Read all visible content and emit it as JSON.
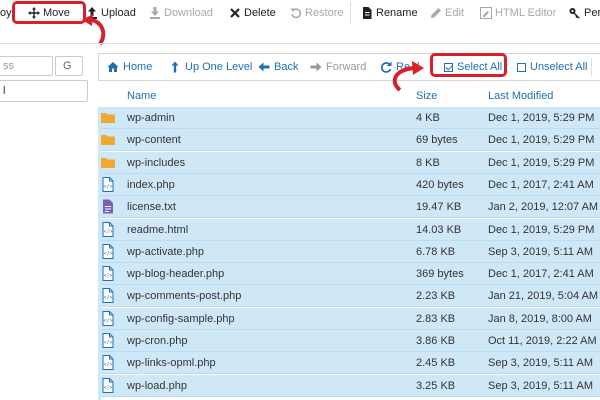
{
  "toolbar": {
    "partial_left": "oy",
    "move": "Move",
    "upload": "Upload",
    "download": "Download",
    "delete": "Delete",
    "restore": "Restore",
    "rename": "Rename",
    "edit": "Edit",
    "html_editor": "HTML Editor",
    "permissions_partial": "Per"
  },
  "left_panel": {
    "search_partial": "ss",
    "go_partial": "G",
    "tree_item_partial": "l"
  },
  "nav": {
    "home": "Home",
    "up_one_level": "Up One Level",
    "back": "Back",
    "forward": "Forward",
    "reload_partial": "Re",
    "reload_tail": "l",
    "select_all": "Select All",
    "unselect_all": "Unselect All"
  },
  "table": {
    "columns": [
      "Name",
      "Size",
      "Last Modified"
    ],
    "rows": [
      {
        "type": "folder",
        "name": "wp-admin",
        "size": "4 KB",
        "modified": "Dec 1, 2019, 5:29 PM"
      },
      {
        "type": "folder",
        "name": "wp-content",
        "size": "69 bytes",
        "modified": "Dec 1, 2019, 5:29 PM"
      },
      {
        "type": "folder",
        "name": "wp-includes",
        "size": "8 KB",
        "modified": "Dec 1, 2019, 5:29 PM"
      },
      {
        "type": "code",
        "name": "index.php",
        "size": "420 bytes",
        "modified": "Dec 1, 2017, 2:41 AM"
      },
      {
        "type": "text",
        "name": "license.txt",
        "size": "19.47 KB",
        "modified": "Jan 2, 2019, 12:07 AM"
      },
      {
        "type": "code",
        "name": "readme.html",
        "size": "14.03 KB",
        "modified": "Dec 1, 2019, 5:29 PM"
      },
      {
        "type": "code",
        "name": "wp-activate.php",
        "size": "6.78 KB",
        "modified": "Sep 3, 2019, 5:11 AM"
      },
      {
        "type": "code",
        "name": "wp-blog-header.php",
        "size": "369 bytes",
        "modified": "Dec 1, 2017, 2:41 AM"
      },
      {
        "type": "code",
        "name": "wp-comments-post.php",
        "size": "2.23 KB",
        "modified": "Jan 21, 2019, 5:04 AM"
      },
      {
        "type": "code",
        "name": "wp-config-sample.php",
        "size": "2.83 KB",
        "modified": "Jan 8, 2019, 8:00 AM"
      },
      {
        "type": "code",
        "name": "wp-cron.php",
        "size": "3.86 KB",
        "modified": "Oct 11, 2019, 2:22 AM"
      },
      {
        "type": "code",
        "name": "wp-links-opml.php",
        "size": "2.45 KB",
        "modified": "Sep 3, 2019, 5:11 AM"
      },
      {
        "type": "code",
        "name": "wp-load.php",
        "size": "3.25 KB",
        "modified": "Sep 3, 2019, 5:11 AM"
      }
    ]
  },
  "colors": {
    "accent": "#1f6fb5",
    "row_selected": "#cfe8f7",
    "highlight": "#d9202a",
    "folder": "#f0a830",
    "text_file": "#7b5fb3"
  },
  "icons": {
    "move": "move-arrows-icon",
    "upload": "upload-icon",
    "download": "download-icon",
    "delete": "delete-x-icon",
    "restore": "restore-icon",
    "rename": "rename-file-icon",
    "edit": "pencil-icon",
    "html_editor": "html-editor-icon",
    "permissions": "key-icon"
  }
}
